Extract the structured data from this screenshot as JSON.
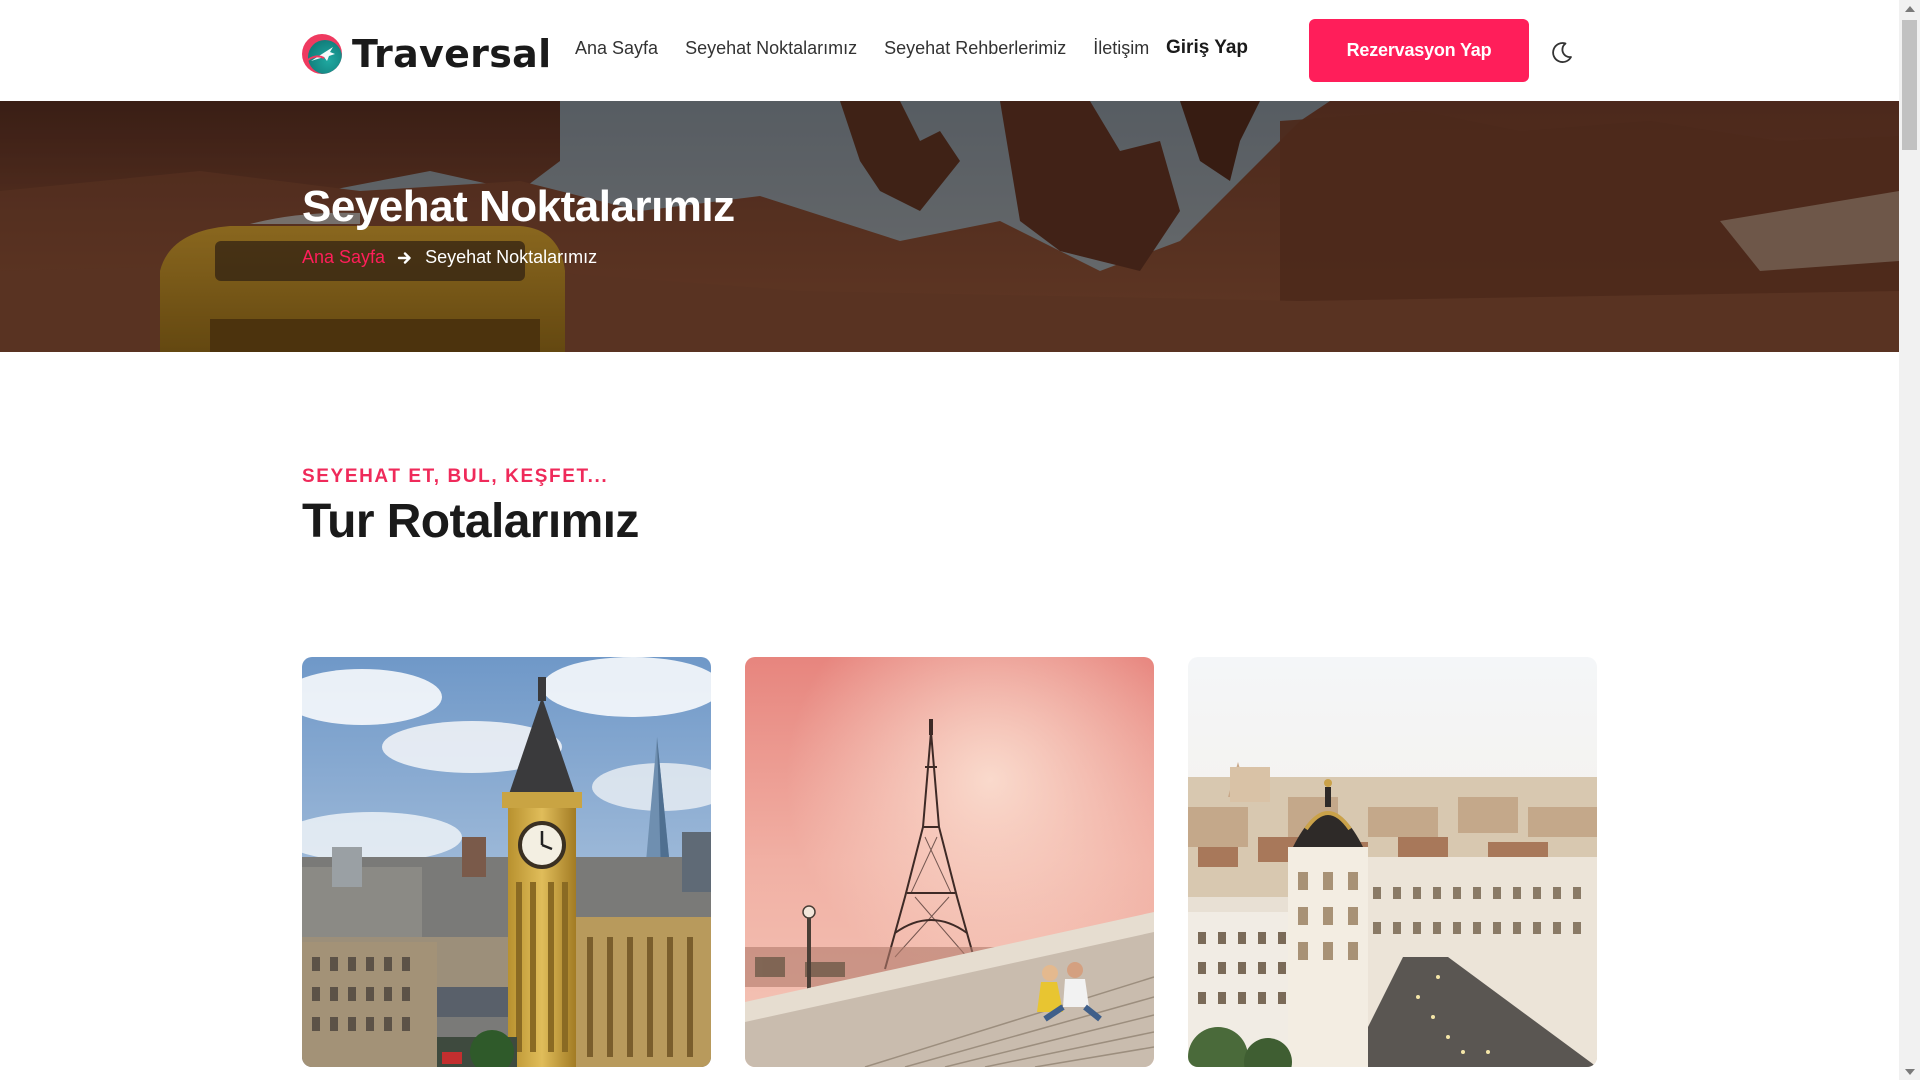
{
  "brand": {
    "name": "Traversal",
    "logo_icon": "globe-plane-icon"
  },
  "nav": {
    "links": [
      {
        "label": "Ana Sayfa"
      },
      {
        "label": "Seyehat Noktalarımız"
      },
      {
        "label": "Seyehat Rehberlerimiz"
      },
      {
        "label": "İletişim"
      }
    ],
    "login_label": "Giriş Yap",
    "cta_label": "Rezervasyon Yap",
    "theme_icon": "moon-icon"
  },
  "hero": {
    "title": "Seyehat Noktalarımız",
    "breadcrumb": {
      "home": "Ana Sayfa",
      "separator_icon": "arrow-right-icon",
      "current": "Seyehat Noktalarımız"
    }
  },
  "section": {
    "eyebrow": "SEYEHAT ET, BUL, KEŞFET...",
    "title": "Tur Rotalarımız"
  },
  "cards": [
    {
      "image": "london-big-ben-image"
    },
    {
      "image": "paris-eiffel-tower-image"
    },
    {
      "image": "madrid-metropolis-image"
    }
  ],
  "colors": {
    "accent": "#ff1e5a",
    "text": "#1a1a1a",
    "background": "#ffffff"
  }
}
